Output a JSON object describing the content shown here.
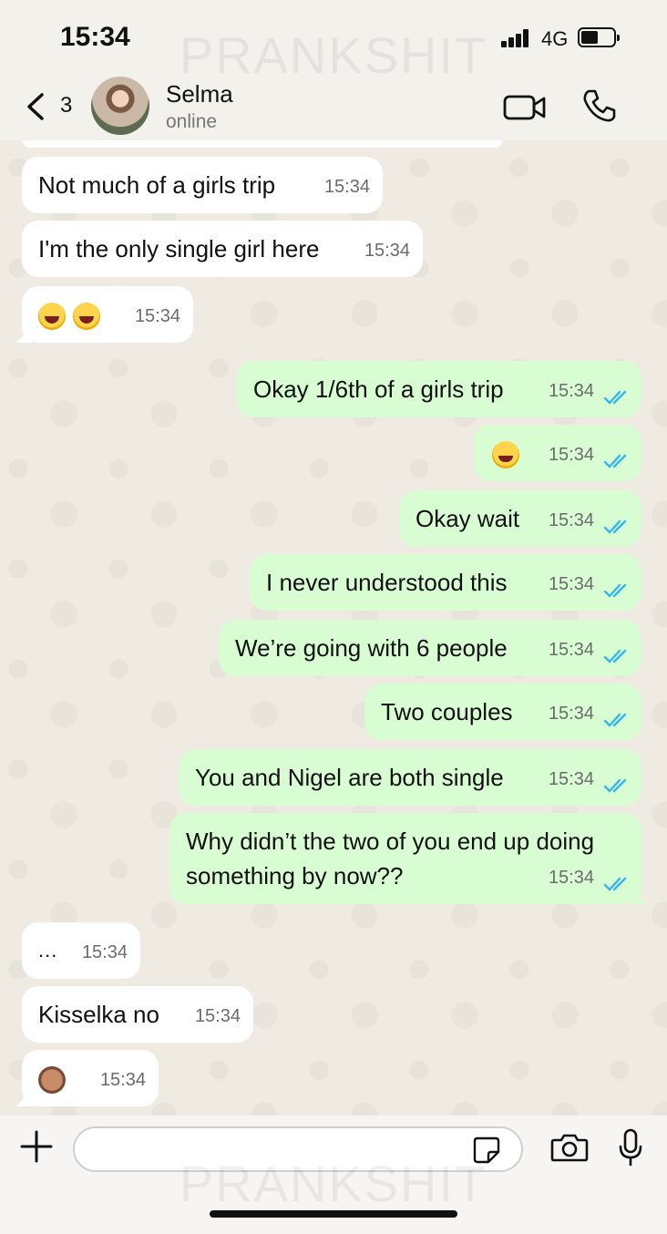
{
  "status_bar": {
    "time": "15:34",
    "network": "4G"
  },
  "header": {
    "back_count": "3",
    "contact_name": "Selma",
    "presence": "online"
  },
  "watermark": "PRANKSHIT",
  "messages": [
    {
      "dir": "in",
      "text": "Not much of a girls trip",
      "time": "15:34"
    },
    {
      "dir": "in",
      "text": "I'm the only single girl here",
      "time": "15:34"
    },
    {
      "dir": "in",
      "emoji": [
        "laughing-tears-emoji",
        "laughing-tears-emoji"
      ],
      "time": "15:34"
    },
    {
      "dir": "out",
      "text": "Okay 1/6th of a girls trip",
      "time": "15:34",
      "status": "read"
    },
    {
      "dir": "out",
      "emoji": [
        "grinning-sweat-emoji"
      ],
      "time": "15:34",
      "status": "read"
    },
    {
      "dir": "out",
      "text": "Okay wait",
      "time": "15:34",
      "status": "read"
    },
    {
      "dir": "out",
      "text": "I never understood this",
      "time": "15:34",
      "status": "read"
    },
    {
      "dir": "out",
      "text": "We’re going with 6 people",
      "time": "15:34",
      "status": "read"
    },
    {
      "dir": "out",
      "text": "Two couples",
      "time": "15:34",
      "status": "read"
    },
    {
      "dir": "out",
      "text": "You and Nigel are both single",
      "time": "15:34",
      "status": "read"
    },
    {
      "dir": "out",
      "text": "Why didn’t the two of you end up doing something by now??",
      "time": "15:34",
      "status": "read"
    },
    {
      "dir": "in",
      "text": "...",
      "time": "15:34"
    },
    {
      "dir": "in",
      "text": "Kisselka no",
      "time": "15:34"
    },
    {
      "dir": "in",
      "emoji": [
        "see-no-evil-monkey-emoji"
      ],
      "time": "15:34"
    }
  ],
  "input": {
    "placeholder": ""
  },
  "colors": {
    "incoming_bubble": "#ffffff",
    "outgoing_bubble": "#d9fdd3",
    "read_ticks": "#34b7f1",
    "chat_bg": "#efeae2"
  }
}
